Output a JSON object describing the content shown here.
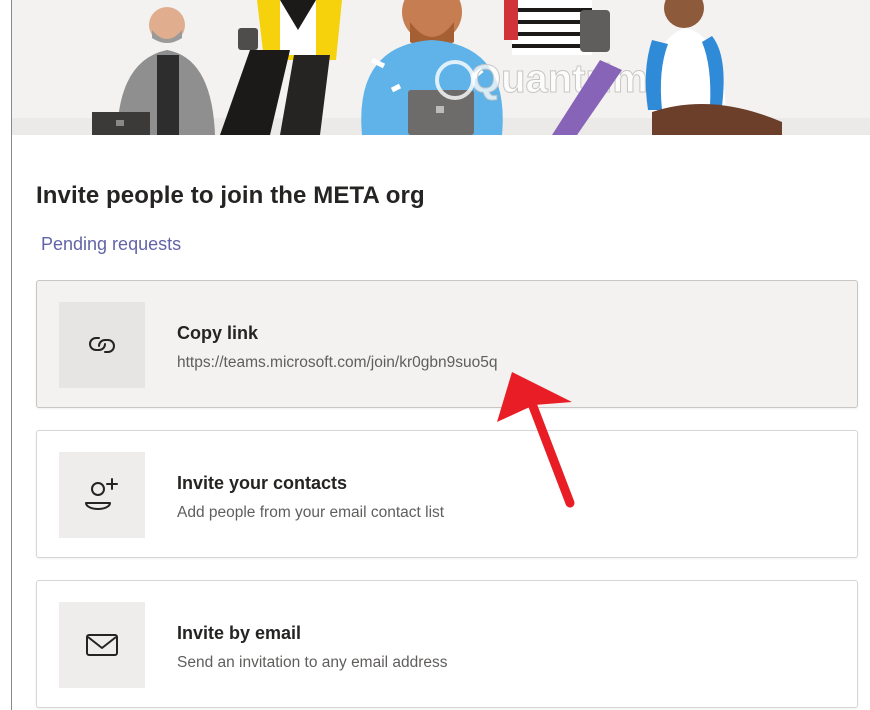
{
  "header": {
    "watermark": "Quantrimang"
  },
  "invite": {
    "title": "Invite people to join the META org",
    "pending_link": "Pending requests"
  },
  "options": [
    {
      "label": "Copy link",
      "subtitle": "https://teams.microsoft.com/join/kr0gbn9suo5q",
      "icon": "link-icon",
      "highlighted": true
    },
    {
      "label": "Invite your contacts",
      "subtitle": "Add people from your email contact list",
      "icon": "add-person-icon",
      "highlighted": false
    },
    {
      "label": "Invite by email",
      "subtitle": "Send an invitation to any email address",
      "icon": "mail-icon",
      "highlighted": false
    }
  ],
  "colors": {
    "accent": "#6264a7",
    "annotation_arrow": "#e81d25",
    "card_highlight": "#f3f2f1"
  }
}
